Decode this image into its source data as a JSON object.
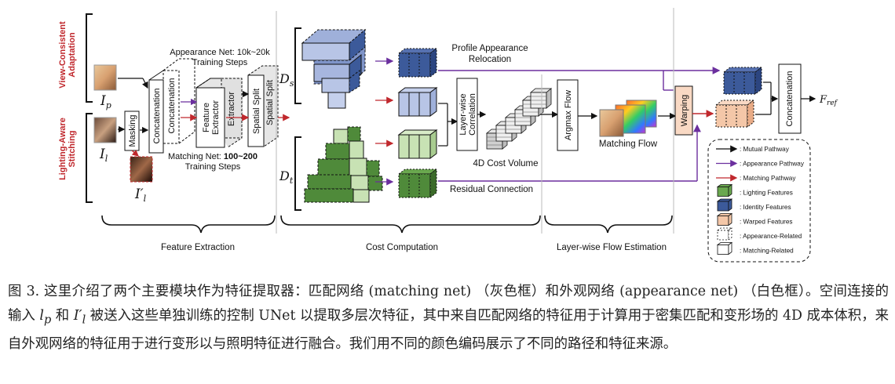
{
  "figure": {
    "side_labels": {
      "top": [
        "View-Consistent",
        "Adaptation"
      ],
      "bottom": [
        "Lighting-Aware",
        "Stitching"
      ]
    },
    "inputs": {
      "ip": "I",
      "ip_sub": "p",
      "il": "I",
      "il_sub": "l",
      "il_prime": "I′",
      "il_prime_sub": "l"
    },
    "masking": "Masking",
    "concatenation_a": "Concatenation",
    "concatenation_b": "Concatenation",
    "feature_extractor_a": [
      "Feature",
      "Extractor"
    ],
    "feature_extractor_b": "Extractor",
    "spatial_split_a": "Spatial Split",
    "spatial_split_b": "Spatial Split",
    "appearance_net": [
      "Appearance Net: 10k~20k",
      "Training Steps"
    ],
    "matching_net": {
      "prefix": "Matching Net: ",
      "steps": "100~200",
      "line2": "Training Steps"
    },
    "ds": "D",
    "ds_sub": "s",
    "dt": "D",
    "dt_sub": "t",
    "profile": [
      "Profile Appearance",
      "Relocation"
    ],
    "layerwise_corr": [
      "Layer-wise",
      "Correlation"
    ],
    "cost_volume": "4D Cost Volume",
    "residual": "Residual Connection",
    "argmax": "Argmax Flow",
    "matching_flow": "Matching Flow",
    "warping": "Warping",
    "concatenation_final": "Concatenation",
    "fref": "F",
    "fref_sub": "ref",
    "sections": [
      "Feature Extraction",
      "Cost Computation",
      "Layer-wise Flow Estimation"
    ],
    "legend": [
      {
        "text": ": Mutual Pathway",
        "kind": "arrow",
        "color": "#111111"
      },
      {
        "text": ": Appearance Pathway",
        "kind": "arrow",
        "color": "#6b2f9e"
      },
      {
        "text": ": Matching Pathway",
        "kind": "arrow",
        "color": "#c0282d"
      },
      {
        "text": ": Lighting Features",
        "kind": "cube",
        "color": "#6aa84f"
      },
      {
        "text": ": Identity Features",
        "kind": "cube",
        "color": "#3c5a9a"
      },
      {
        "text": ": Warped Features",
        "kind": "cube",
        "color": "#f4c7a8"
      },
      {
        "text": ": Appearance-Related",
        "kind": "cube-dash",
        "color": "#ffffff"
      },
      {
        "text": ": Matching-Related",
        "kind": "cube",
        "color": "#ffffff"
      }
    ]
  },
  "caption": {
    "seg1": "图 3. 这里介绍了两个主要模块作为特征提取器：匹配网络 (matching net) （灰色框）和外观网络 (appearance net) （白色框）。空间连接的输入 ",
    "m1": "l",
    "m1_sub": "p",
    "seg2": " 和 ",
    "m2": "I′",
    "m2_sub": "l",
    "seg3": " 被送入这些单独训练的控制 UNet 以提取多层次特征，其中来自匹配网络的特征用于计算用于密集匹配和变形场的 4D 成本体积，来自外观网络的特征用于进行变形以与照明特征进行融合。我们用不同的颜色编码展示了不同的路径和特征来源。"
  }
}
